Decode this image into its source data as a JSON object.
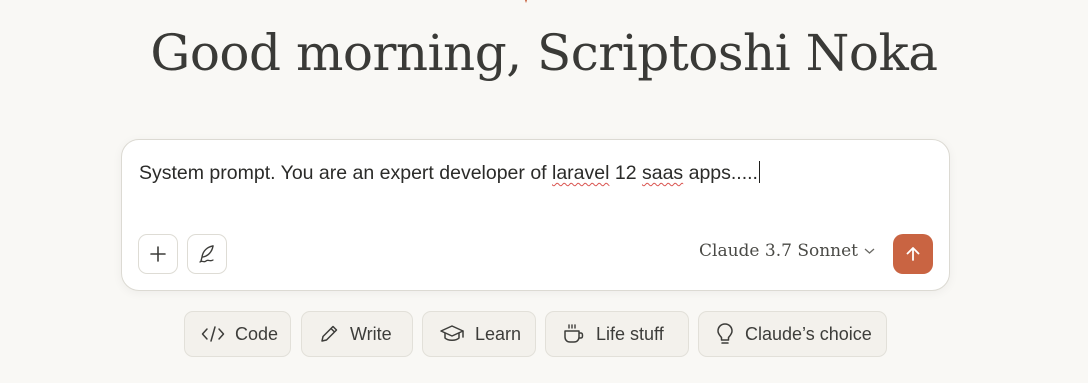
{
  "greeting": "Good morning, Scriptoshi Noka",
  "composer": {
    "text_before": "System prompt. You are an expert developer of ",
    "misspelled_1": "laravel",
    "text_middle": " 12 ",
    "misspelled_2": "saas",
    "text_after": " apps.....",
    "model_label": "Claude 3.7 Sonnet"
  },
  "chips": [
    {
      "label": "Code",
      "icon": "code-icon"
    },
    {
      "label": "Write",
      "icon": "pencil-icon"
    },
    {
      "label": "Learn",
      "icon": "graduation-cap-icon"
    },
    {
      "label": "Life stuff",
      "icon": "coffee-cup-icon"
    },
    {
      "label": "Claude’s choice",
      "icon": "lightbulb-icon"
    }
  ],
  "colors": {
    "background": "#f9f8f5",
    "accent": "#c96442",
    "spellcheck": "#d9534f"
  }
}
